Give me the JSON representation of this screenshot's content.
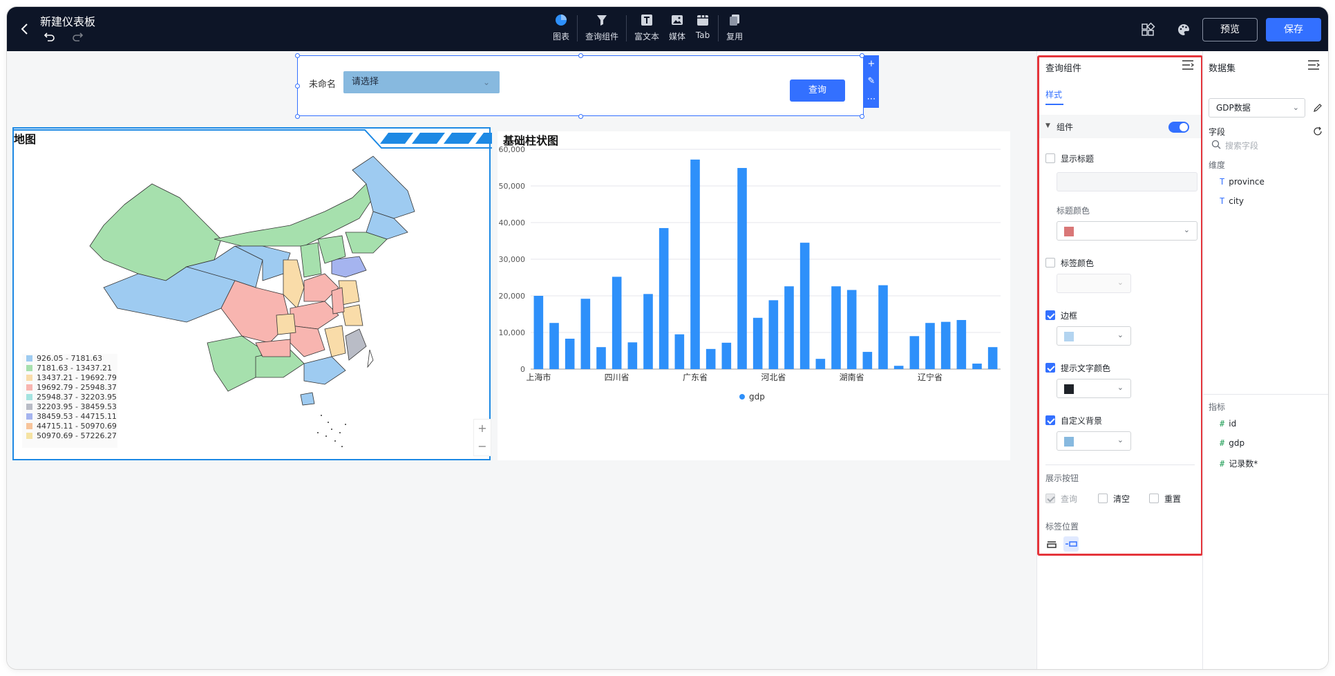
{
  "header": {
    "title": "新建仪表板",
    "tools": [
      {
        "label": "图表",
        "icon": "pie-chart-icon"
      },
      {
        "label": "查询组件",
        "icon": "filter-icon"
      },
      {
        "label": "富文本",
        "icon": "text-icon"
      },
      {
        "label": "媒体",
        "icon": "image-icon"
      },
      {
        "label": "Tab",
        "icon": "tab-icon"
      },
      {
        "label": "复用",
        "icon": "copy-icon"
      }
    ],
    "preview_label": "预览",
    "save_label": "保存"
  },
  "query": {
    "field_label": "未命名",
    "select_placeholder": "请选择",
    "button_label": "查询"
  },
  "map": {
    "title": "地图",
    "legend": [
      {
        "label": "926.05 - 7181.63",
        "color": "#9ecbf1"
      },
      {
        "label": "7181.63 - 13437.21",
        "color": "#a6e0ad"
      },
      {
        "label": "13437.21 - 19692.79",
        "color": "#f9dca9"
      },
      {
        "label": "19692.79 - 25948.37",
        "color": "#f8b5b0"
      },
      {
        "label": "25948.37 - 32203.95",
        "color": "#a4e3e0"
      },
      {
        "label": "32203.95 - 38459.53",
        "color": "#b9bcc6"
      },
      {
        "label": "38459.53 - 44715.11",
        "color": "#a5b4ef"
      },
      {
        "label": "44715.11 - 50970.69",
        "color": "#f7c49b"
      },
      {
        "label": "50970.69 - 57226.27",
        "color": "#f5e3a3"
      }
    ],
    "zoom_in": "+",
    "zoom_out": "−"
  },
  "bar_chart_title": "基础柱状图",
  "chart_data": {
    "type": "bar",
    "title": "基础柱状图",
    "categories": [
      "上海市",
      "",
      "",
      "",
      "",
      "四川省",
      "",
      "",
      "",
      "",
      "广东省",
      "",
      "",
      "",
      "",
      "河北省",
      "",
      "",
      "",
      "",
      "湖南省",
      "",
      "",
      "",
      "",
      "辽宁省",
      "",
      "",
      "",
      ""
    ],
    "x_tick_labels": [
      "上海市",
      "四川省",
      "广东省",
      "河北省",
      "湖南省",
      "辽宁省"
    ],
    "y_tick_labels": [
      "0",
      "10,000",
      "20,000",
      "30,000",
      "40,000",
      "50,000",
      "60,000"
    ],
    "ylim": [
      0,
      60000
    ],
    "series": [
      {
        "name": "gdp",
        "color": "#2e90fa",
        "values": [
          20000,
          12600,
          8300,
          19200,
          6000,
          25200,
          7300,
          20500,
          38500,
          9500,
          57200,
          5500,
          7200,
          54900,
          14000,
          18800,
          22600,
          34500,
          2800,
          22600,
          21600,
          4700,
          22900,
          900,
          9000,
          12600,
          12900,
          13400,
          1500,
          6000
        ]
      }
    ],
    "legend": [
      "gdp"
    ],
    "grid": true
  },
  "panel": {
    "title": "查询组件",
    "tab_style": "样式",
    "section_component": "组件",
    "show_title": "显示标题",
    "title_color": "标题颜色",
    "label_color": "标签颜色",
    "border": "边框",
    "hint_text_color": "提示文字颜色",
    "custom_bg": "自定义背景",
    "show_buttons": "展示按钮",
    "btn_query": "查询",
    "btn_clear": "清空",
    "btn_reset": "重置",
    "label_position": "标签位置",
    "colors": {
      "title_color": "#d97777",
      "border_color": "#b3d4f0",
      "hint_color": "#1f2329",
      "bg_color": "#87b9df"
    }
  },
  "dataset": {
    "title": "数据集",
    "selected": "GDP数据",
    "fields_title": "字段",
    "search_placeholder": "搜索字段",
    "dimension_title": "维度",
    "dimensions": [
      "province",
      "city"
    ],
    "metric_title": "指标",
    "metrics": [
      "id",
      "gdp",
      "记录数*"
    ]
  }
}
